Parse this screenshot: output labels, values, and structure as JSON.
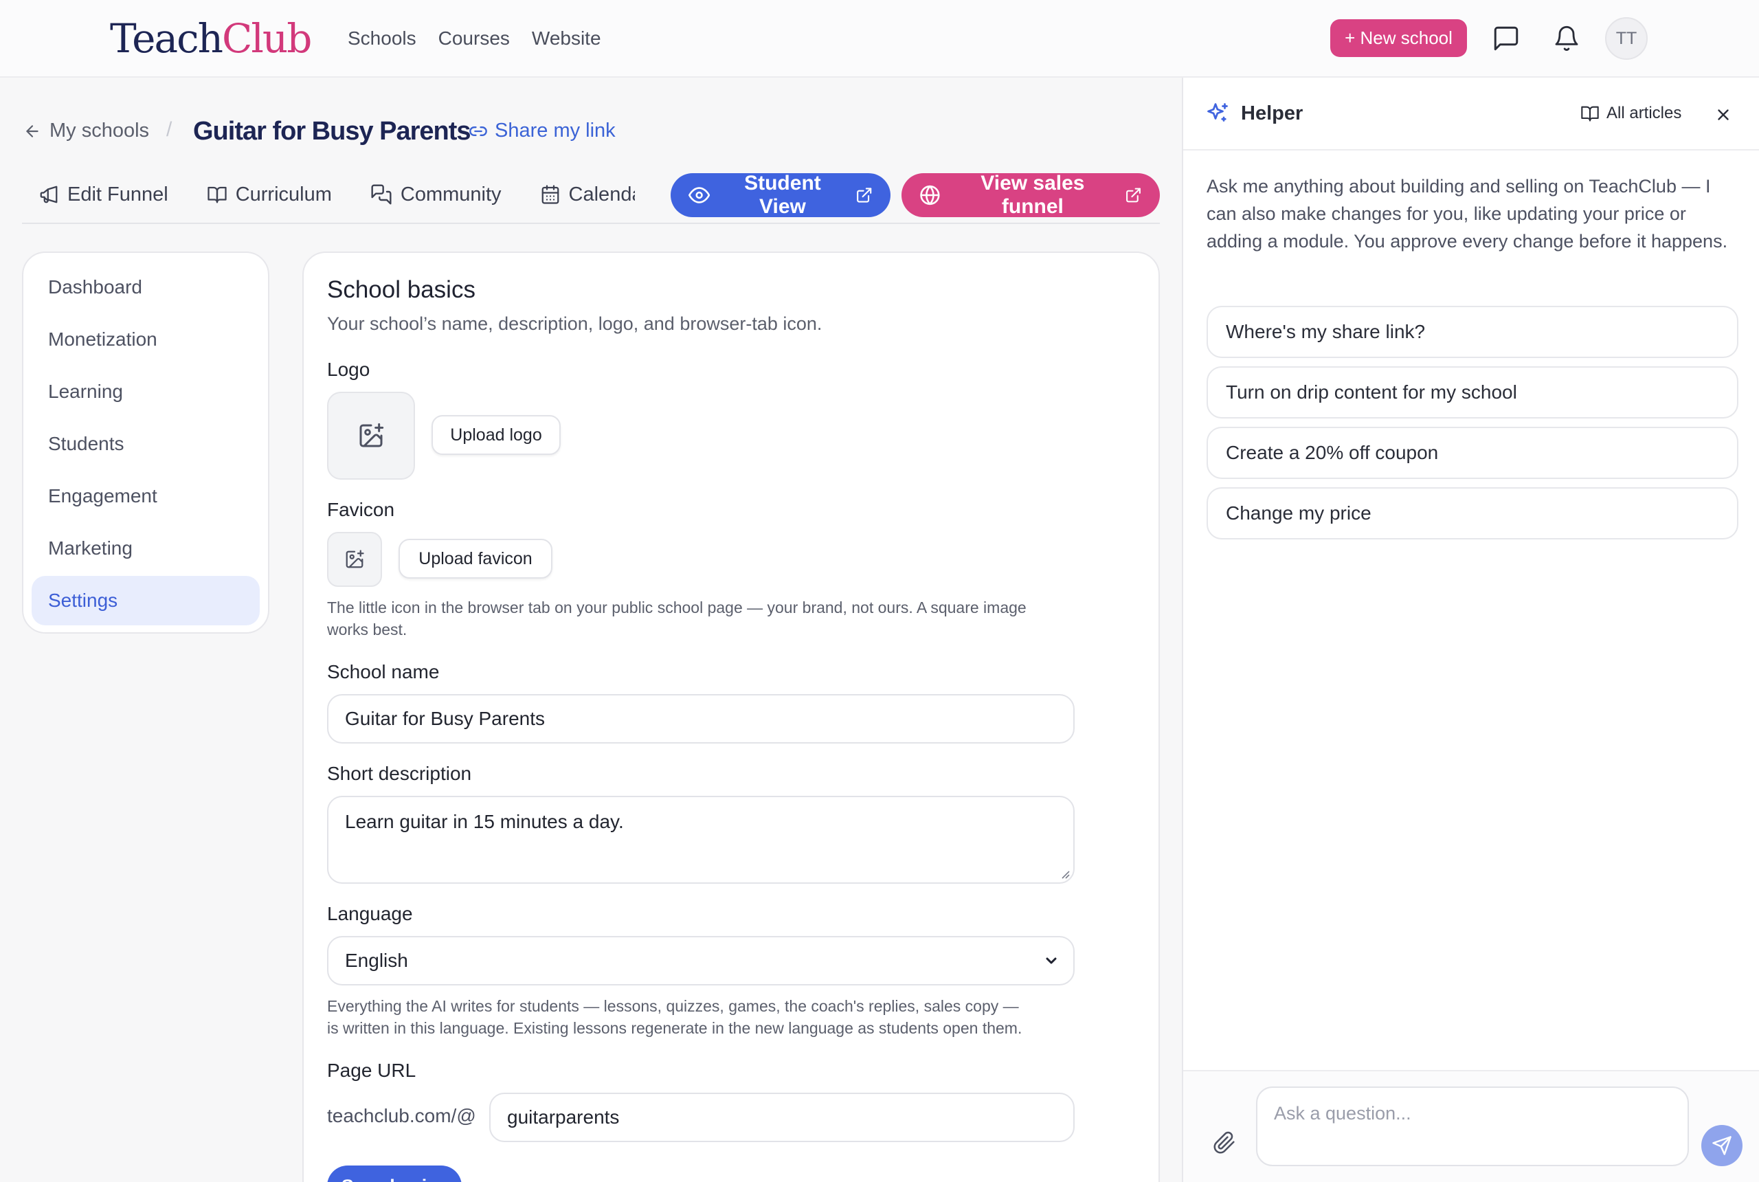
{
  "brand": {
    "part1": "Teach",
    "part2": "Club"
  },
  "topnav": {
    "items": [
      "Schools",
      "Courses",
      "Website"
    ]
  },
  "topbar": {
    "new_school": "+ New school",
    "avatar_initials": "TT"
  },
  "header": {
    "back_label": "My schools",
    "separator": "/",
    "title": "Guitar for Busy Parents",
    "share_label": "Share my link"
  },
  "tabs": {
    "items": [
      "Edit Funnel",
      "Curriculum",
      "Community",
      "Calendar"
    ],
    "student_view": "Student View",
    "sales_funnel": "View sales funnel"
  },
  "sidebar": {
    "items": [
      "Dashboard",
      "Monetization",
      "Learning",
      "Students",
      "Engagement",
      "Marketing",
      "Settings"
    ],
    "active": "Settings"
  },
  "basics": {
    "title": "School basics",
    "subtitle": "Your school’s name, description, logo, and browser-tab icon.",
    "logo_label": "Logo",
    "upload_logo": "Upload logo",
    "favicon_label": "Favicon",
    "upload_favicon": "Upload favicon",
    "favicon_help_1": "The little icon in the browser tab on your public school page — your brand, not ours. A square image",
    "favicon_help_2": "works best.",
    "name_label": "School name",
    "name_value": "Guitar for Busy Parents",
    "desc_label": "Short description",
    "desc_value": "Learn guitar in 15 minutes a day.",
    "language_label": "Language",
    "language_value": "English",
    "language_help_1": "Everything the AI writes for students — lessons, quizzes, games, the coach's replies, sales copy —",
    "language_help_2": "is written in this language. Existing lessons regenerate in the new language as students open them.",
    "url_label": "Page URL",
    "url_prefix": "teachclub.com/@",
    "url_value": "guitarparents",
    "save_label": "Save basics"
  },
  "helper": {
    "title": "Helper",
    "all_articles": "All articles",
    "intro": "Ask me anything about building and selling on TeachClub — I can also make changes for you, like updating your price or adding a module. You approve every change before it happens.",
    "suggestions": [
      "Where's my share link?",
      "Turn on drip content for my school",
      "Create a 20% off coupon",
      "Change my price"
    ],
    "input_placeholder": "Ask a question..."
  },
  "colors": {
    "brand_navy": "#1d2554",
    "brand_pink": "#d94283",
    "primary_blue": "#3f63df",
    "active_bg": "#e8edfd"
  },
  "icons": {
    "messages": "message-square-icon",
    "notifications": "bell-icon",
    "back": "arrow-left-icon",
    "share": "link-icon",
    "edit_funnel": "megaphone-icon",
    "curriculum": "book-open-icon",
    "community": "messages-icon",
    "calendar": "calendar-icon",
    "student_view": "eye-icon",
    "sales_funnel": "globe-icon",
    "external": "external-link-icon",
    "upload": "image-plus-icon",
    "helper": "sparkles-icon",
    "articles": "book-open-icon",
    "close": "x-icon",
    "attach": "paperclip-icon",
    "send": "send-icon"
  }
}
